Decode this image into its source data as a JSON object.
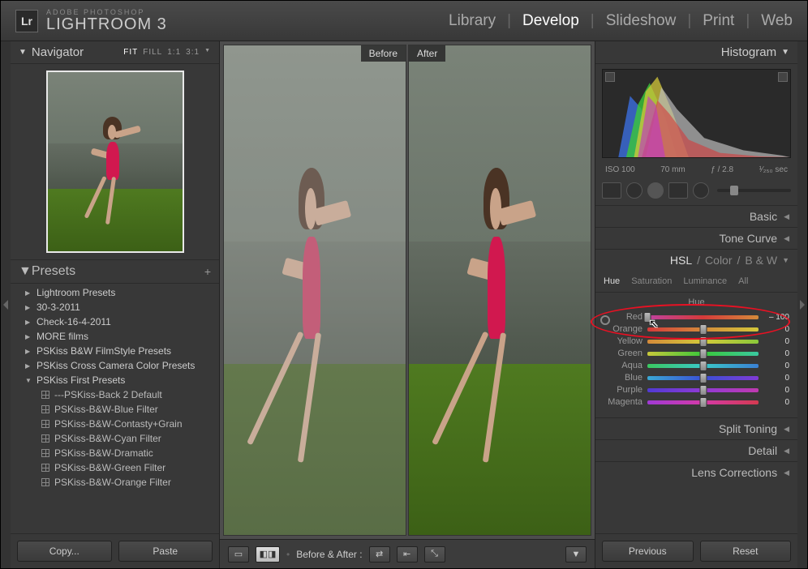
{
  "app": {
    "logo_abbr": "Lr",
    "logo_sub": "ADOBE PHOTOSHOP",
    "logo_main": "LIGHTROOM 3"
  },
  "modules": {
    "library": "Library",
    "develop": "Develop",
    "slideshow": "Slideshow",
    "print": "Print",
    "web": "Web",
    "active": "develop"
  },
  "navigator": {
    "title": "Navigator",
    "zoom": {
      "fit": "FIT",
      "fill": "FILL",
      "one": "1:1",
      "three": "3:1"
    }
  },
  "presets": {
    "title": "Presets",
    "folders": [
      {
        "name": "Lightroom Presets",
        "open": false
      },
      {
        "name": "30-3-2011",
        "open": false
      },
      {
        "name": "Check-16-4-2011",
        "open": false
      },
      {
        "name": "MORE films",
        "open": false
      },
      {
        "name": "PSKiss B&W FilmStyle Presets",
        "open": false
      },
      {
        "name": "PSKiss Cross Camera Color Presets",
        "open": false
      },
      {
        "name": "PSKiss First Presets",
        "open": true,
        "items": [
          "---PSKiss-Back 2 Default",
          "PSKiss-B&W-Blue Filter",
          "PSKiss-B&W-Contasty+Grain",
          "PSKiss-B&W-Cyan Filter",
          "PSKiss-B&W-Dramatic",
          "PSKiss-B&W-Green Filter",
          "PSKiss-B&W-Orange Filter"
        ]
      }
    ],
    "copy_btn": "Copy...",
    "paste_btn": "Paste"
  },
  "compare": {
    "before": "Before",
    "after": "After",
    "toolbar_label": "Before & After :"
  },
  "histogram": {
    "title": "Histogram",
    "iso": "ISO 100",
    "focal": "70 mm",
    "aperture": "ƒ / 2.8",
    "shutter": "¹⁄₂₅₀ sec"
  },
  "sections": {
    "basic": "Basic",
    "tone_curve": "Tone Curve",
    "split_toning": "Split Toning",
    "detail": "Detail",
    "lens_corrections": "Lens Corrections"
  },
  "hsl": {
    "hsl": "HSL",
    "color": "Color",
    "bw": "B & W",
    "tab_hue": "Hue",
    "tab_saturation": "Saturation",
    "tab_luminance": "Luminance",
    "tab_all": "All",
    "panel_title": "Hue",
    "sliders": [
      {
        "label": "Red",
        "value": "– 100",
        "pos": 0,
        "grad": "linear-gradient(90deg,#c042a0,#d43a3a,#d48a3a)"
      },
      {
        "label": "Orange",
        "value": "0",
        "pos": 50,
        "grad": "linear-gradient(90deg,#d43a3a,#d48a3a,#d4c83a)"
      },
      {
        "label": "Yellow",
        "value": "0",
        "pos": 50,
        "grad": "linear-gradient(90deg,#d48a3a,#d4c83a,#8ac83a)"
      },
      {
        "label": "Green",
        "value": "0",
        "pos": 50,
        "grad": "linear-gradient(90deg,#c8c83a,#3ac83a,#3ac8a0)"
      },
      {
        "label": "Aqua",
        "value": "0",
        "pos": 50,
        "grad": "linear-gradient(90deg,#3ac860,#3ac8c8,#3a80d4)"
      },
      {
        "label": "Blue",
        "value": "0",
        "pos": 50,
        "grad": "linear-gradient(90deg,#3aa8d4,#3a50d4,#803ad4)"
      },
      {
        "label": "Purple",
        "value": "0",
        "pos": 50,
        "grad": "linear-gradient(90deg,#503ad4,#903ad4,#c03ab0)"
      },
      {
        "label": "Magenta",
        "value": "0",
        "pos": 50,
        "grad": "linear-gradient(90deg,#a03ad4,#d43aa8,#d43a50)"
      }
    ]
  },
  "footer": {
    "previous": "Previous",
    "reset": "Reset"
  }
}
